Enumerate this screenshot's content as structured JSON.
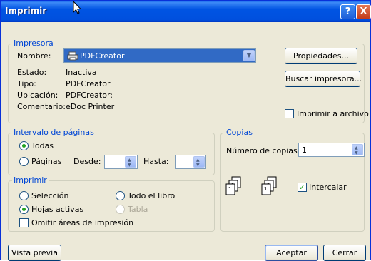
{
  "window": {
    "title": "Imprimir",
    "help_btn": "?",
    "close_btn": "X"
  },
  "printer": {
    "legend": "Impresora",
    "name_label": "Nombre:",
    "name_value": "PDFCreator",
    "state_label": "Estado:",
    "state_value": "Inactiva",
    "type_label": "Tipo:",
    "type_value": "PDFCreator",
    "location_label": "Ubicación:",
    "location_value": "PDFCreator:",
    "comment_label": "Comentario:",
    "comment_value": "eDoc Printer",
    "properties_btn": "Propiedades...",
    "find_btn": "Buscar impresora...",
    "print_to_file": "Imprimir a archivo",
    "print_to_file_checked": false
  },
  "range": {
    "legend": "Intervalo de páginas",
    "all": "Todas",
    "pages": "Páginas",
    "from_label": "Desde:",
    "to_label": "Hasta:",
    "from_value": "",
    "to_value": "",
    "selected": "all"
  },
  "what": {
    "legend": "Imprimir",
    "selection": "Selección",
    "whole_book": "Todo el libro",
    "active_sheets": "Hojas activas",
    "table": "Tabla",
    "ignore_areas": "Omitir áreas de impresión",
    "ignore_areas_checked": false,
    "selected": "active_sheets"
  },
  "copies": {
    "legend": "Copias",
    "count_label": "Número de copias:",
    "count_value": "1",
    "collate": "Intercalar",
    "collate_checked": true
  },
  "footer": {
    "preview_btn": "Vista previa",
    "ok_btn": "Aceptar",
    "cancel_btn": "Cerrar"
  }
}
